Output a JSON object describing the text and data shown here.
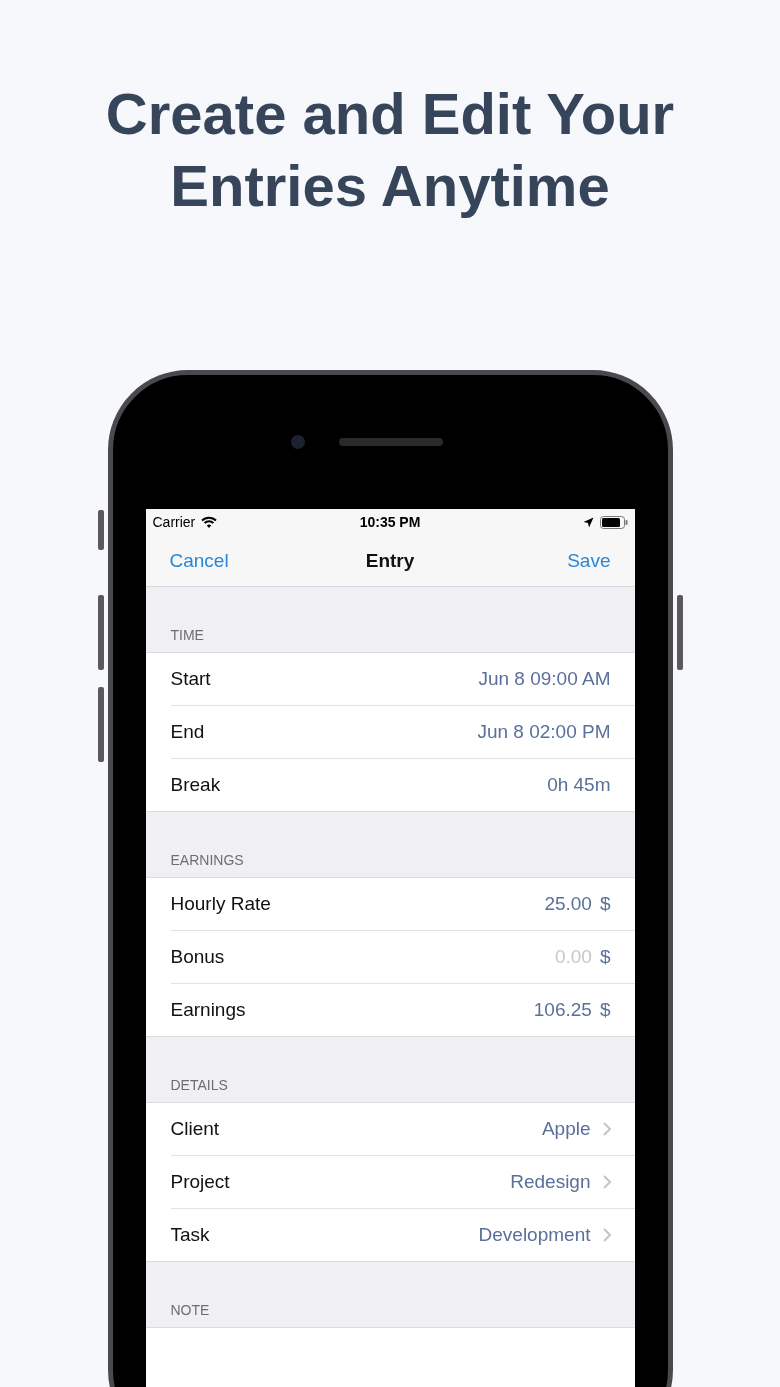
{
  "headline": "Create and Edit Your Entries Anytime",
  "status_bar": {
    "carrier": "Carrier",
    "time": "10:35 PM"
  },
  "nav_bar": {
    "left": "Cancel",
    "title": "Entry",
    "right": "Save"
  },
  "sections": [
    {
      "header": "TIME",
      "rows": [
        {
          "kind": "value",
          "label": "Start",
          "value": "Jun 8 09:00 AM"
        },
        {
          "kind": "value",
          "label": "End",
          "value": "Jun 8 02:00 PM"
        },
        {
          "kind": "value",
          "label": "Break",
          "value": "0h 45m"
        }
      ]
    },
    {
      "header": "EARNINGS",
      "rows": [
        {
          "kind": "amount",
          "label": "Hourly Rate",
          "value": "25.00",
          "unit": "$"
        },
        {
          "kind": "amount",
          "label": "Bonus",
          "placeholder": "0.00",
          "unit": "$"
        },
        {
          "kind": "amount",
          "label": "Earnings",
          "value": "106.25",
          "unit": "$"
        }
      ]
    },
    {
      "header": "DETAILS",
      "rows": [
        {
          "kind": "link",
          "label": "Client",
          "value": "Apple"
        },
        {
          "kind": "link",
          "label": "Project",
          "value": "Redesign"
        },
        {
          "kind": "link",
          "label": "Task",
          "value": "Development"
        }
      ]
    },
    {
      "header": "NOTE",
      "rows": [
        {
          "kind": "note"
        }
      ]
    }
  ]
}
